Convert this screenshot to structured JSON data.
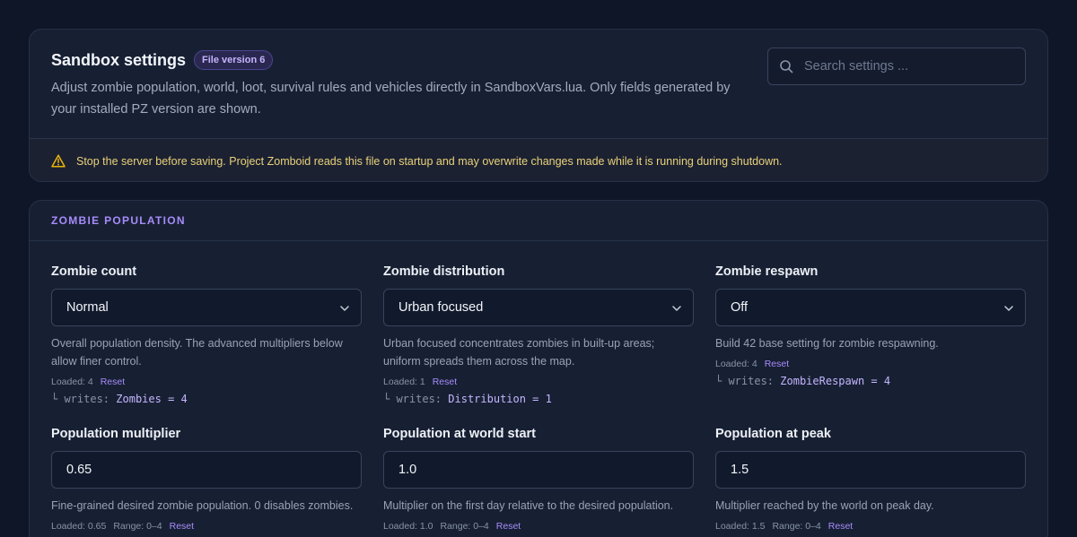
{
  "header": {
    "title": "Sandbox settings",
    "version_badge": "File version 6",
    "subtitle": "Adjust zombie population, world, loot, survival rules and vehicles directly in SandboxVars.lua. Only fields generated by your installed PZ version are shown.",
    "search_placeholder": "Search settings ...",
    "warning": "Stop the server before saving. Project Zomboid reads this file on startup and may overwrite changes made while it is running during shutdown."
  },
  "section": {
    "title": "ZOMBIE POPULATION",
    "fields": [
      {
        "label": "Zombie count",
        "value": "Normal",
        "help": "Overall population density. The advanced multipliers below allow finer control.",
        "loaded": "Loaded: 4",
        "reset": "Reset",
        "writes_prefix": "└ writes:",
        "writes_code": "Zombies = 4"
      },
      {
        "label": "Zombie distribution",
        "value": "Urban focused",
        "help": "Urban focused concentrates zombies in built-up areas; uniform spreads them across the map.",
        "loaded": "Loaded: 1",
        "reset": "Reset",
        "writes_prefix": "└ writes:",
        "writes_code": "Distribution = 1"
      },
      {
        "label": "Zombie respawn",
        "value": "Off",
        "help": "Build 42 base setting for zombie respawning.",
        "loaded": "Loaded: 4",
        "reset": "Reset",
        "writes_prefix": "└ writes:",
        "writes_code": "ZombieRespawn = 4"
      },
      {
        "label": "Population multiplier",
        "value": "0.65",
        "help": "Fine-grained desired zombie population. 0 disables zombies.",
        "loaded": "Loaded: 0.65",
        "range": "Range: 0–4",
        "reset": "Reset"
      },
      {
        "label": "Population at world start",
        "value": "1.0",
        "help": "Multiplier on the first day relative to the desired population.",
        "loaded": "Loaded: 1.0",
        "range": "Range: 0–4",
        "reset": "Reset"
      },
      {
        "label": "Population at peak",
        "value": "1.5",
        "help": "Multiplier reached by the world on peak day.",
        "loaded": "Loaded: 1.5",
        "range": "Range: 0–4",
        "reset": "Reset"
      }
    ]
  },
  "icons": {
    "search": "search-icon",
    "warning": "warning-icon",
    "chevron": "chevron-down-icon"
  },
  "colors": {
    "background": "#0f1628",
    "card": "#172033",
    "accent": "#a78bfa",
    "warning_text": "#ead27a"
  }
}
